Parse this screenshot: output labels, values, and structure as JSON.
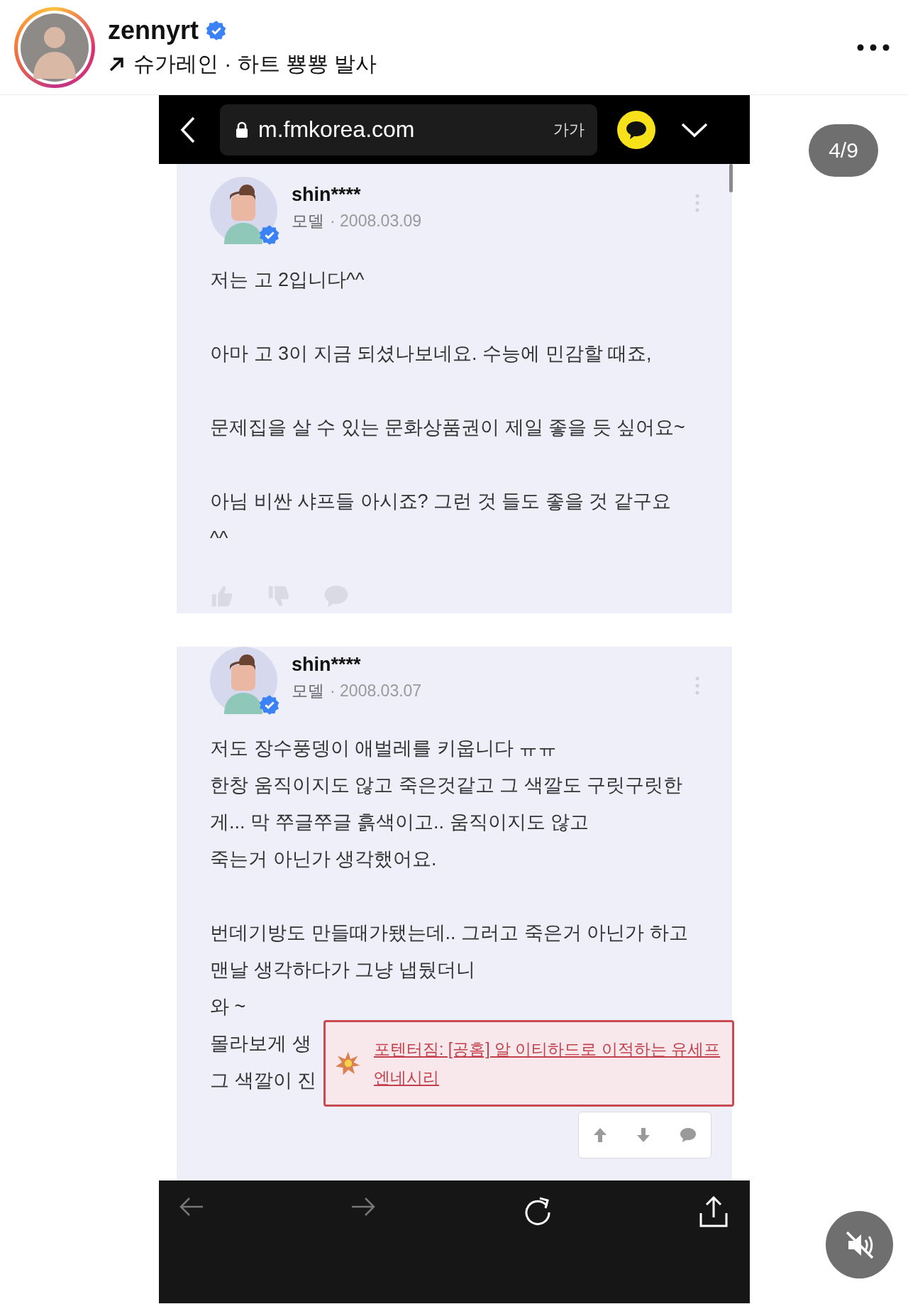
{
  "post_header": {
    "username": "zennyrt",
    "verified": true,
    "subtitle": "슈가레인 · 하트 뿅뿅 발사"
  },
  "page_counter": "4/9",
  "browser": {
    "url": "m.fmkorea.com",
    "text_size": "가가"
  },
  "comments": [
    {
      "username": "shin****",
      "verified": true,
      "role": "모델",
      "date": "· 2008.03.09",
      "kind": "plain",
      "paragraphs": [
        [
          "저는 고 2입니다^^"
        ],
        [
          "아마 고 3이 지금 되셨나보네요. 수능에 민감할 때죠,"
        ],
        [
          "문제집을 살 수 있는 문화상품권이 제일 좋을 듯 싶어요~"
        ],
        [
          "아님 비싼 샤프들 아시죠? 그런 것 들도 좋을 것 같구요",
          "^^"
        ]
      ]
    },
    {
      "username": "shin****",
      "verified": true,
      "role": "모델",
      "date": "· 2008.03.07",
      "kind": "boxed",
      "paragraphs": [
        [
          "저도 장수풍뎅이 애벌레를 키웁니다 ㅠㅠ",
          "한창 움직이지도 않고 죽은것같고 그 색깔도 구릿구릿한",
          "게... 막 쭈글쭈글 흙색이고.. 움직이지도 않고",
          "죽는거 아닌가 생각했어요."
        ],
        [
          "번데기방도 만들때가됐는데.. 그러고 죽은거 아닌가 하고",
          "맨날 생각하다가 그냥 냅뒀더니",
          "와 ~",
          "몰라보게 생",
          "그 색깔이 진"
        ]
      ]
    }
  ],
  "ad_popup": {
    "lines": [
      "포텐터짐: [공홈] 알 이티하드로 이적하는 유세프",
      "엔네시리"
    ]
  }
}
